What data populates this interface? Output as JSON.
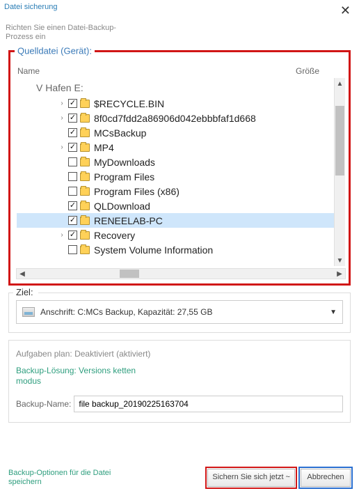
{
  "window": {
    "title": "Datei sicherung",
    "description": "Richten Sie einen Datei-Backup-Prozess ein"
  },
  "source": {
    "legend": "Quelldatei (Gerät):",
    "header_name": "Name",
    "header_size": "Größe",
    "root_label": "V Hafen E:",
    "items": [
      {
        "label": "$RECYCLE.BIN",
        "checked": true,
        "expandable": true,
        "selected": false
      },
      {
        "label": "8f0cd7fdd2a86906d042ebbbfaf1d668",
        "checked": true,
        "expandable": true,
        "selected": false
      },
      {
        "label": "MCsBackup",
        "checked": true,
        "expandable": false,
        "selected": false
      },
      {
        "label": "MP4",
        "checked": true,
        "expandable": true,
        "selected": false
      },
      {
        "label": "MyDownloads",
        "checked": false,
        "expandable": false,
        "selected": false
      },
      {
        "label": "Program Files",
        "checked": false,
        "expandable": false,
        "selected": false
      },
      {
        "label": "Program Files (x86)",
        "checked": false,
        "expandable": false,
        "selected": false
      },
      {
        "label": "QLDownload",
        "checked": true,
        "expandable": false,
        "selected": false
      },
      {
        "label": "RENEELAB-PC",
        "checked": true,
        "expandable": false,
        "selected": true
      },
      {
        "label": "Recovery",
        "checked": true,
        "expandable": true,
        "selected": false
      },
      {
        "label": "System Volume Information",
        "checked": false,
        "expandable": false,
        "selected": false
      }
    ]
  },
  "destination": {
    "legend": "Ziel:",
    "text": "Anschrift: C:MCs Backup, Kapazität: 27,55 GB"
  },
  "schedule": {
    "plan_text": "Aufgaben plan: Deaktiviert (aktiviert)",
    "solution_text": "Backup-Lösung: Versions ketten modus",
    "name_label": "Backup-Name:",
    "name_value": "file backup_20190225163704"
  },
  "footer": {
    "options_link": "Backup-Optionen für die Datei speichern",
    "primary_btn": "Sichern Sie sich jetzt ~",
    "cancel_btn": "Abbrechen"
  }
}
